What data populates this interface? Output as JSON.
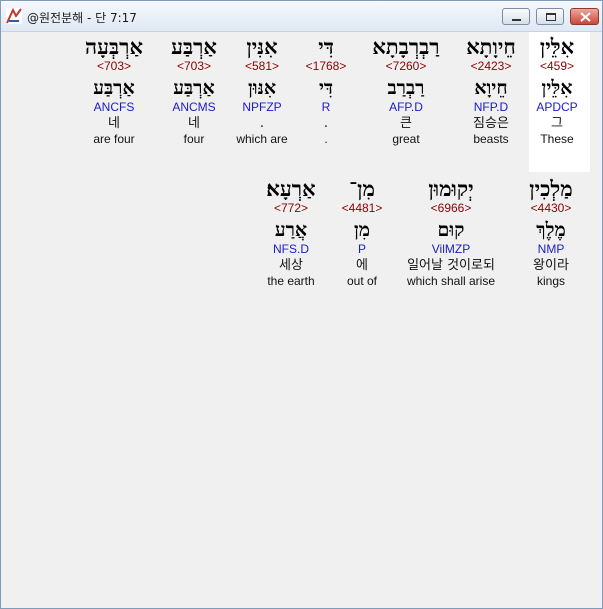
{
  "window": {
    "title": "@원전분해 - 단 7:17",
    "controls": {
      "minimize": "minimize",
      "maximize": "maximize",
      "close": "close"
    }
  },
  "verse": {
    "rows": [
      {
        "words": [
          {
            "hebrew": "אִלֵּין",
            "number": "<459>",
            "lemma": "אִלֵּין",
            "parsing": "APDCP",
            "korean": "그",
            "english": "These",
            "highlighted": true
          },
          {
            "hebrew": "חֵיוָתָא",
            "number": "<2423>",
            "lemma": "חֵיוָא",
            "parsing": "NFP.D",
            "korean": "짐승은",
            "english": "beasts"
          },
          {
            "hebrew": "רַבְרְבָתָא",
            "number": "<7260>",
            "lemma": "רַבְרַב",
            "parsing": "AFP.D",
            "korean": "큰",
            "english": "great"
          },
          {
            "hebrew": "דִּי",
            "number": "<1768>",
            "lemma": "דִּי",
            "parsing": "R",
            "korean": ".",
            "english": "."
          },
          {
            "hebrew": "אִנִּין",
            "number": "<581>",
            "lemma": "אִנּוּן",
            "parsing": "NPFZP",
            "korean": ".",
            "english": "which are"
          },
          {
            "hebrew": "אַרְבַּע",
            "number": "<703>",
            "lemma": "אַרְבַּע",
            "parsing": "ANCMS",
            "korean": "네",
            "english": "four"
          },
          {
            "hebrew": "אַרְבְּעָה",
            "number": "<703>",
            "lemma": "אַרְבַּע",
            "parsing": "ANCFS",
            "korean": "네",
            "english": "are four"
          }
        ]
      },
      {
        "words": [
          {
            "hebrew": "מַלְכִין",
            "number": "<4430>",
            "lemma": "מֶלֶךְ",
            "parsing": "NMP",
            "korean": "왕이라",
            "english": "kings"
          },
          {
            "hebrew": "יְקוּמוּן",
            "number": "<6966>",
            "lemma": "קוּם",
            "parsing": "VilMZP",
            "korean": "일어날 것이로되",
            "english": "which shall arise"
          },
          {
            "hebrew": "מִן־",
            "number": "<4481>",
            "lemma": "מִן",
            "parsing": "P",
            "korean": "에",
            "english": "out of"
          },
          {
            "hebrew": "אַרְעָא׃",
            "number": "<772>",
            "lemma": "אֲרַע",
            "parsing": "NFS.D",
            "korean": "세상",
            "english": "the earth"
          }
        ]
      }
    ]
  }
}
